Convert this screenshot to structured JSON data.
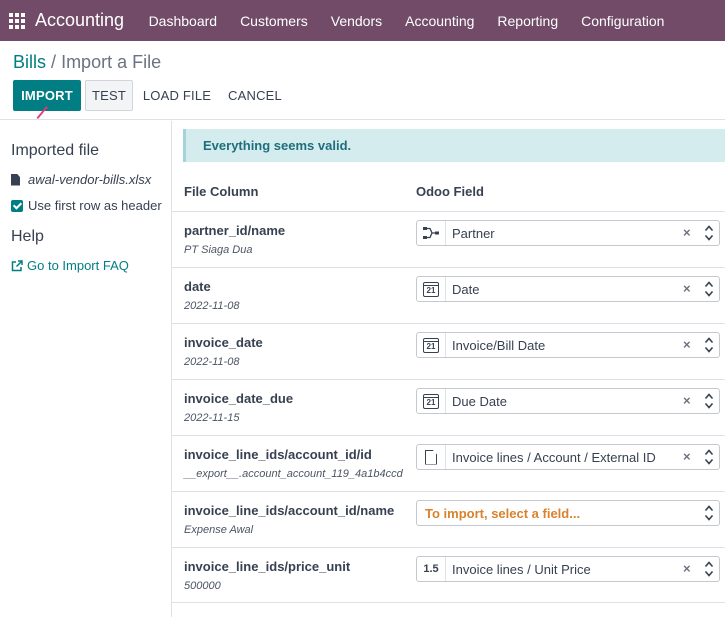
{
  "navbar": {
    "app_name": "Accounting",
    "menu": [
      "Dashboard",
      "Customers",
      "Vendors",
      "Accounting",
      "Reporting",
      "Configuration"
    ],
    "color": "#714B67"
  },
  "breadcrumb": {
    "parent": "Bills",
    "separator": "/",
    "current": "Import a File"
  },
  "actions": {
    "import": "IMPORT",
    "test": "TEST",
    "load_file": "LOAD FILE",
    "cancel": "CANCEL"
  },
  "sidebar": {
    "imported_title": "Imported file",
    "file_name": "awal-vendor-bills.xlsx",
    "header_option": "Use first row as header",
    "header_checked": true,
    "help_title": "Help",
    "faq_link": "Go to Import FAQ"
  },
  "main": {
    "alert": "Everything seems valid.",
    "col_file": "File Column",
    "col_odoo": "Odoo Field",
    "rows": [
      {
        "column": "partner_id/name",
        "sample": "PT Siaga Dua",
        "icon": "relation-icon",
        "field": "Partner"
      },
      {
        "column": "date",
        "sample": "2022-11-08",
        "icon": "calendar-icon",
        "icon_text": "21",
        "field": "Date"
      },
      {
        "column": "invoice_date",
        "sample": "2022-11-08",
        "icon": "calendar-icon",
        "icon_text": "21",
        "field": "Invoice/Bill Date"
      },
      {
        "column": "invoice_date_due",
        "sample": "2022-11-15",
        "icon": "calendar-icon",
        "icon_text": "21",
        "field": "Due Date"
      },
      {
        "column": "invoice_line_ids/account_id/id",
        "sample": "__export__.account_account_119_4a1b4ccd",
        "icon": "document-icon",
        "field": "Invoice lines / Account / External ID"
      },
      {
        "column": "invoice_line_ids/account_id/name",
        "sample": "Expense Awal",
        "icon": "",
        "field": "",
        "placeholder": "To import, select a field..."
      },
      {
        "column": "invoice_line_ids/price_unit",
        "sample": "500000",
        "icon": "float-icon",
        "icon_text": "1.5",
        "field": "Invoice lines / Unit Price"
      }
    ],
    "clear_symbol": "×"
  }
}
